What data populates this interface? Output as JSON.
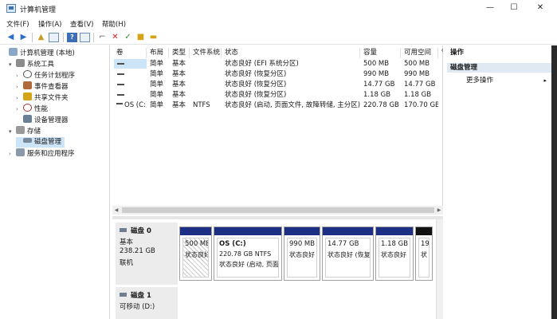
{
  "window": {
    "title": "计算机管理",
    "controls": {
      "minimize": "—",
      "maximize": "☐",
      "close": "✕"
    }
  },
  "menu": [
    "文件(F)",
    "操作(A)",
    "查看(V)",
    "帮助(H)"
  ],
  "toolbar": {
    "buttons": [
      "back-arrow",
      "forward-arrow",
      "up-folder",
      "show-tree",
      "help",
      "properties",
      "connect",
      "delete",
      "checklist",
      "new-folder",
      "folder-open"
    ]
  },
  "tree": {
    "items": [
      {
        "label": "计算机管理 (本地)",
        "icon": "computer-icon",
        "arrow": ""
      },
      {
        "label": "系统工具",
        "icon": "toolbox-icon",
        "arrow": "▾"
      },
      {
        "label": "任务计划程序",
        "icon": "clock-icon",
        "arrow": "›"
      },
      {
        "label": "事件查看器",
        "icon": "event-icon",
        "arrow": "›"
      },
      {
        "label": "共享文件夹",
        "icon": "share-icon",
        "arrow": "›"
      },
      {
        "label": "性能",
        "icon": "performance-icon",
        "arrow": "›"
      },
      {
        "label": "设备管理器",
        "icon": "device-icon",
        "arrow": ""
      },
      {
        "label": "存储",
        "icon": "storage-icon",
        "arrow": "▾"
      },
      {
        "label": "磁盘管理",
        "icon": "disk-icon",
        "arrow": ""
      },
      {
        "label": "服务和应用程序",
        "icon": "services-icon",
        "arrow": "›"
      }
    ],
    "selected_index": 8
  },
  "volumes": {
    "columns": [
      "卷",
      "布局",
      "类型",
      "文件系统",
      "状态",
      "容量",
      "可用空间",
      "%"
    ],
    "rows": [
      {
        "name": "",
        "layout": "简单",
        "type": "基本",
        "fs": "",
        "status": "状态良好 (EFI 系统分区)",
        "capacity": "500 MB",
        "free": "500 MB",
        "pct": ""
      },
      {
        "name": "",
        "layout": "简单",
        "type": "基本",
        "fs": "",
        "status": "状态良好 (恢复分区)",
        "capacity": "990 MB",
        "free": "990 MB",
        "pct": ""
      },
      {
        "name": "",
        "layout": "简单",
        "type": "基本",
        "fs": "",
        "status": "状态良好 (恢复分区)",
        "capacity": "14.77 GB",
        "free": "14.77 GB",
        "pct": ""
      },
      {
        "name": "",
        "layout": "简单",
        "type": "基本",
        "fs": "",
        "status": "状态良好 (恢复分区)",
        "capacity": "1.18 GB",
        "free": "1.18 GB",
        "pct": ""
      },
      {
        "name": "OS (C:)",
        "layout": "简单",
        "type": "基本",
        "fs": "NTFS",
        "status": "状态良好 (启动, 页面文件, 故障转储, 主分区)",
        "capacity": "220.78 GB",
        "free": "170.70 GB",
        "pct": ""
      }
    ]
  },
  "disks": [
    {
      "title": "磁盘 0",
      "lines": [
        "基本",
        "238.21 GB",
        "联机"
      ],
      "partitions": [
        {
          "l1": "500 MB",
          "l2": "状态良好",
          "l3": "",
          "hatched": true,
          "band": "#1c2f85"
        },
        {
          "l1": "OS  (C:)",
          "l2": "220.78 GB NTFS",
          "l3": "状态良好 (启动, 页面",
          "hatched": false,
          "band": "#1c2f85"
        },
        {
          "l1": "990 MB",
          "l2": "状态良好",
          "l3": "",
          "hatched": false,
          "band": "#1c2f85"
        },
        {
          "l1": "14.77 GB",
          "l2": "状态良好 (恢复",
          "l3": "",
          "hatched": false,
          "band": "#1c2f85"
        },
        {
          "l1": "1.18 GB",
          "l2": "状态良好",
          "l3": "",
          "hatched": false,
          "band": "#1c2f85"
        },
        {
          "l1": "19",
          "l2": "状",
          "l3": "",
          "hatched": false,
          "band": "#111111"
        }
      ]
    },
    {
      "title": "磁盘 1",
      "lines": [
        "可移动 (D:)"
      ],
      "partitions": []
    }
  ],
  "actions": {
    "header": "操作",
    "section": "磁盘管理",
    "items": [
      "更多操作"
    ],
    "more_arrow": "▸"
  },
  "colors": {
    "partition_band": "#1c2f85",
    "selection": "#cce4f7",
    "panel_header": "#e0e8f2"
  }
}
